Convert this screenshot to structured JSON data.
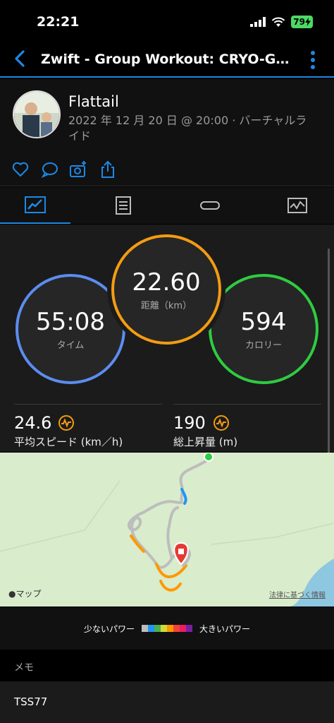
{
  "status_bar": {
    "time": "22:21",
    "battery": "79"
  },
  "header": {
    "title": "Zwift - Group Workout: CRYO-GEN..."
  },
  "profile": {
    "name": "Flattail",
    "meta": "2022 年 12 月 20 日 @ 20:00 · バーチャルライド"
  },
  "stats": {
    "distance": {
      "value": "22.60",
      "label": "距離（km）"
    },
    "time": {
      "value": "55:08",
      "label": "タイム"
    },
    "calories": {
      "value": "594",
      "label": "カロリー"
    },
    "avg_speed": {
      "value": "24.6",
      "label": "平均スピード (km／h)"
    },
    "elevation": {
      "value": "190",
      "label": "総上昇量 (m)"
    }
  },
  "map": {
    "attribution": "マップ",
    "legal": "法律に基づく情報"
  },
  "legend": {
    "low": "少ないパワー",
    "high": "大きいパワー",
    "colors": [
      "#bdbdbd",
      "#2196f3",
      "#4caf50",
      "#cddc39",
      "#ff9800",
      "#f44336",
      "#e91e63",
      "#7b1fa2"
    ]
  },
  "memo": {
    "label": "メモ",
    "text": "TSS77"
  },
  "colors": {
    "accent": "#1e88e5",
    "time_ring": "#5b8def",
    "distance_ring": "#f39c12",
    "calories_ring": "#2ecc40"
  }
}
